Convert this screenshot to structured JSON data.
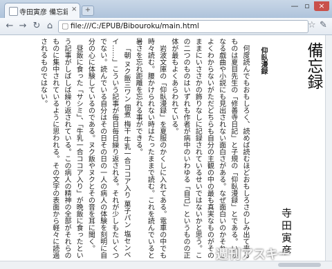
{
  "tab": {
    "title": "寺田寅彦 備忘録",
    "close_glyph": "×"
  },
  "new_tab_glyph": "+",
  "window_controls": {
    "minimize": "—",
    "maximize": "▫",
    "close": "×"
  },
  "toolbar": {
    "back_glyph": "←",
    "forward_glyph": "→",
    "reload_glyph": "↻",
    "url": "file:///C:/EPUB/Bibouroku/main.html",
    "page_icon": "📄",
    "star_glyph": "☆",
    "wrench_glyph": "🔧"
  },
  "document": {
    "title": "備忘録",
    "label": "仰臥漫録",
    "author": "寺田寅彦",
    "paragraphs": [
      "何度読んでもおもしろく、読めば読むほどおもしろさのしみ出て来るものは夏目先生の「修善寺日記」と子規の「仰臥漫録」とである。いかなる戯曲や小説にも見出されない面白さがある。なぜ面白いのかそれはよくわからないがただどちらも自分の主観の中の最も真実なものがそのままにいささかの飾りなしに記録されているせいではないかと思う。この二つのものはいずれも作者が病中のいわゆる「自己」というものの正体が最もよくあらわれている。",
      "岩波文庫の「仰臥漫録」を夏服のかくしに入れてある。電車の中でも時々読む。腰かけられない時はたったままで読む。これを読んでいると暑さを忘れ距離を忘れる事ができる。",
      "「朝 ヌク飯三ワン 佃煮 梅干 牛乳一合ココア入り 菓子パン 塩センベイ……」こういう記事が毎日毎日繰り返される。それが少しもたいくつでない。読んでいる自分はその日その日の一人の病人の体験を刻明に自分の心に体験しているのである。ヌク飯やヌクとその音を耳に聞く。",
      "昼飯に食った「サシミ」、「牛乳一合ココア入り」が晩飯に食ったという記事がしばしば繰り返されている。この病人の精神の全部がそれらのものに集中されているように思われる。その文字の表面から軽々に読過されるものではない。"
    ]
  },
  "watermark": "週刊アスキー"
}
